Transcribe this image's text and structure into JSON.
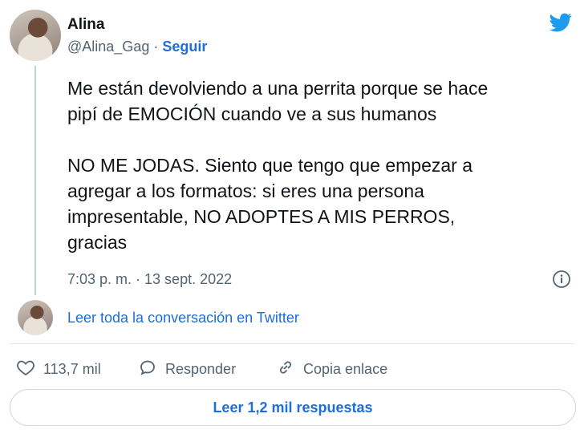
{
  "author": {
    "name": "Alina",
    "handle": "@Alina_Gag",
    "separator": "·",
    "follow_label": "Seguir"
  },
  "tweet": {
    "line1": "Me están devolviendo a una perrita porque se hace",
    "line2": "pipí de EMOCIÓN cuando ve a sus humanos",
    "line3": "NO ME JODAS. Siento que tengo que empezar a",
    "line4": "agregar a los formatos: si eres una persona",
    "line5": "impresentable, NO ADOPTES A MIS PERROS,",
    "line6": "gracias",
    "timestamp": "7:03 p. m. · 13 sept. 2022"
  },
  "conversation_link": "Leer toda la conversación en Twitter",
  "actions": {
    "likes": "113,7 mil",
    "reply": "Responder",
    "copy_link": "Copia enlace"
  },
  "read_replies": "Leer 1,2 mil respuestas",
  "colors": {
    "accent": "#1d6ed8",
    "twitter_blue": "#1d9bf0",
    "muted": "#536471"
  }
}
